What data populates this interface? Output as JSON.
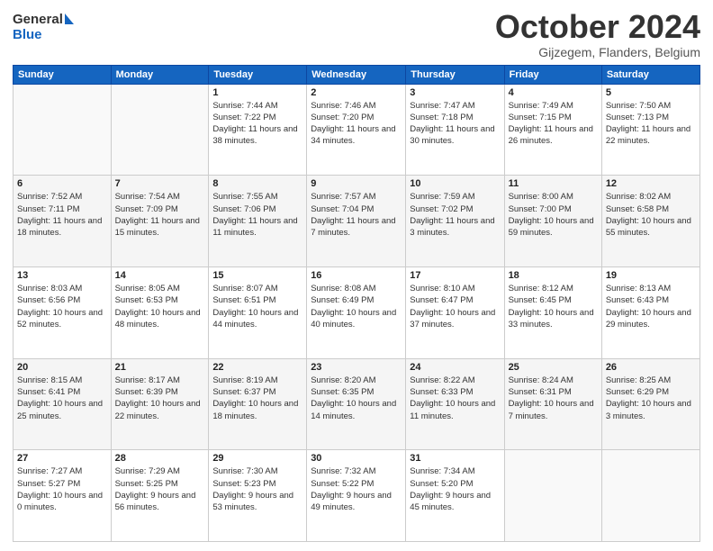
{
  "header": {
    "logo_line1": "General",
    "logo_line2": "Blue",
    "month": "October 2024",
    "location": "Gijzegem, Flanders, Belgium"
  },
  "weekdays": [
    "Sunday",
    "Monday",
    "Tuesday",
    "Wednesday",
    "Thursday",
    "Friday",
    "Saturday"
  ],
  "weeks": [
    [
      {
        "day": "",
        "info": ""
      },
      {
        "day": "",
        "info": ""
      },
      {
        "day": "1",
        "info": "Sunrise: 7:44 AM\nSunset: 7:22 PM\nDaylight: 11 hours and 38 minutes."
      },
      {
        "day": "2",
        "info": "Sunrise: 7:46 AM\nSunset: 7:20 PM\nDaylight: 11 hours and 34 minutes."
      },
      {
        "day": "3",
        "info": "Sunrise: 7:47 AM\nSunset: 7:18 PM\nDaylight: 11 hours and 30 minutes."
      },
      {
        "day": "4",
        "info": "Sunrise: 7:49 AM\nSunset: 7:15 PM\nDaylight: 11 hours and 26 minutes."
      },
      {
        "day": "5",
        "info": "Sunrise: 7:50 AM\nSunset: 7:13 PM\nDaylight: 11 hours and 22 minutes."
      }
    ],
    [
      {
        "day": "6",
        "info": "Sunrise: 7:52 AM\nSunset: 7:11 PM\nDaylight: 11 hours and 18 minutes."
      },
      {
        "day": "7",
        "info": "Sunrise: 7:54 AM\nSunset: 7:09 PM\nDaylight: 11 hours and 15 minutes."
      },
      {
        "day": "8",
        "info": "Sunrise: 7:55 AM\nSunset: 7:06 PM\nDaylight: 11 hours and 11 minutes."
      },
      {
        "day": "9",
        "info": "Sunrise: 7:57 AM\nSunset: 7:04 PM\nDaylight: 11 hours and 7 minutes."
      },
      {
        "day": "10",
        "info": "Sunrise: 7:59 AM\nSunset: 7:02 PM\nDaylight: 11 hours and 3 minutes."
      },
      {
        "day": "11",
        "info": "Sunrise: 8:00 AM\nSunset: 7:00 PM\nDaylight: 10 hours and 59 minutes."
      },
      {
        "day": "12",
        "info": "Sunrise: 8:02 AM\nSunset: 6:58 PM\nDaylight: 10 hours and 55 minutes."
      }
    ],
    [
      {
        "day": "13",
        "info": "Sunrise: 8:03 AM\nSunset: 6:56 PM\nDaylight: 10 hours and 52 minutes."
      },
      {
        "day": "14",
        "info": "Sunrise: 8:05 AM\nSunset: 6:53 PM\nDaylight: 10 hours and 48 minutes."
      },
      {
        "day": "15",
        "info": "Sunrise: 8:07 AM\nSunset: 6:51 PM\nDaylight: 10 hours and 44 minutes."
      },
      {
        "day": "16",
        "info": "Sunrise: 8:08 AM\nSunset: 6:49 PM\nDaylight: 10 hours and 40 minutes."
      },
      {
        "day": "17",
        "info": "Sunrise: 8:10 AM\nSunset: 6:47 PM\nDaylight: 10 hours and 37 minutes."
      },
      {
        "day": "18",
        "info": "Sunrise: 8:12 AM\nSunset: 6:45 PM\nDaylight: 10 hours and 33 minutes."
      },
      {
        "day": "19",
        "info": "Sunrise: 8:13 AM\nSunset: 6:43 PM\nDaylight: 10 hours and 29 minutes."
      }
    ],
    [
      {
        "day": "20",
        "info": "Sunrise: 8:15 AM\nSunset: 6:41 PM\nDaylight: 10 hours and 25 minutes."
      },
      {
        "day": "21",
        "info": "Sunrise: 8:17 AM\nSunset: 6:39 PM\nDaylight: 10 hours and 22 minutes."
      },
      {
        "day": "22",
        "info": "Sunrise: 8:19 AM\nSunset: 6:37 PM\nDaylight: 10 hours and 18 minutes."
      },
      {
        "day": "23",
        "info": "Sunrise: 8:20 AM\nSunset: 6:35 PM\nDaylight: 10 hours and 14 minutes."
      },
      {
        "day": "24",
        "info": "Sunrise: 8:22 AM\nSunset: 6:33 PM\nDaylight: 10 hours and 11 minutes."
      },
      {
        "day": "25",
        "info": "Sunrise: 8:24 AM\nSunset: 6:31 PM\nDaylight: 10 hours and 7 minutes."
      },
      {
        "day": "26",
        "info": "Sunrise: 8:25 AM\nSunset: 6:29 PM\nDaylight: 10 hours and 3 minutes."
      }
    ],
    [
      {
        "day": "27",
        "info": "Sunrise: 7:27 AM\nSunset: 5:27 PM\nDaylight: 10 hours and 0 minutes."
      },
      {
        "day": "28",
        "info": "Sunrise: 7:29 AM\nSunset: 5:25 PM\nDaylight: 9 hours and 56 minutes."
      },
      {
        "day": "29",
        "info": "Sunrise: 7:30 AM\nSunset: 5:23 PM\nDaylight: 9 hours and 53 minutes."
      },
      {
        "day": "30",
        "info": "Sunrise: 7:32 AM\nSunset: 5:22 PM\nDaylight: 9 hours and 49 minutes."
      },
      {
        "day": "31",
        "info": "Sunrise: 7:34 AM\nSunset: 5:20 PM\nDaylight: 9 hours and 45 minutes."
      },
      {
        "day": "",
        "info": ""
      },
      {
        "day": "",
        "info": ""
      }
    ]
  ]
}
